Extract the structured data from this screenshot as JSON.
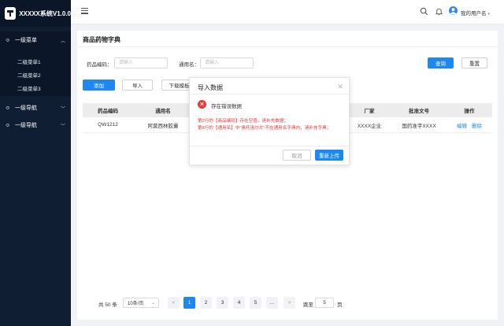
{
  "app": {
    "title": "XXXXX系统V1.0.0"
  },
  "sidebar": {
    "menu1": {
      "label": "一级菜单"
    },
    "submenu": [
      "二级菜单1",
      "二级菜单2",
      "二级菜单3"
    ],
    "nav1": {
      "label": "一级导航"
    },
    "nav2": {
      "label": "一级导航"
    }
  },
  "header": {
    "username": "我的用户名"
  },
  "page": {
    "title": "商品药物字典"
  },
  "filters": {
    "code_label": "药品编码：",
    "code_placeholder": "请输入",
    "name_label": "通用名：",
    "name_placeholder": "请输入",
    "query": "查询",
    "reset": "重置"
  },
  "toolbar": {
    "add": "添加",
    "import": "导入",
    "download": "下载模板"
  },
  "table": {
    "headers": {
      "code": "药品编码",
      "name": "通用名",
      "manufacturer": "厂家",
      "approval": "批准文号",
      "ops": "操作"
    },
    "row": {
      "code": "QW1212",
      "name": "阿莫西林胶囊",
      "manufacturer": "XXXX企业",
      "approval": "国药准字XXXX",
      "edit": "编辑",
      "delete": "删除"
    }
  },
  "pagination": {
    "total": "共 50 条",
    "page_size": "10条/页",
    "prev": "<",
    "pages": [
      "1",
      "2",
      "3",
      "4",
      "5",
      "..."
    ],
    "next": ">",
    "active_page": "1",
    "jump_label": "跳至",
    "jump_value": "5",
    "page_suffix": "页"
  },
  "modal": {
    "title": "导入数据",
    "close": "✕",
    "error_title": "存在错误数据",
    "errors": [
      "第2行的【商品编码】存在空值，请补充数据；",
      "第8行的【通用名】中\"奥托洛尔片\"不在通用名字典内，请补充字典；"
    ],
    "cancel": "取消",
    "reupload": "重新上传"
  },
  "colors": {
    "sidebar_bg": "#0f1e33",
    "primary": "#1e88f2",
    "error": "#e53935"
  }
}
